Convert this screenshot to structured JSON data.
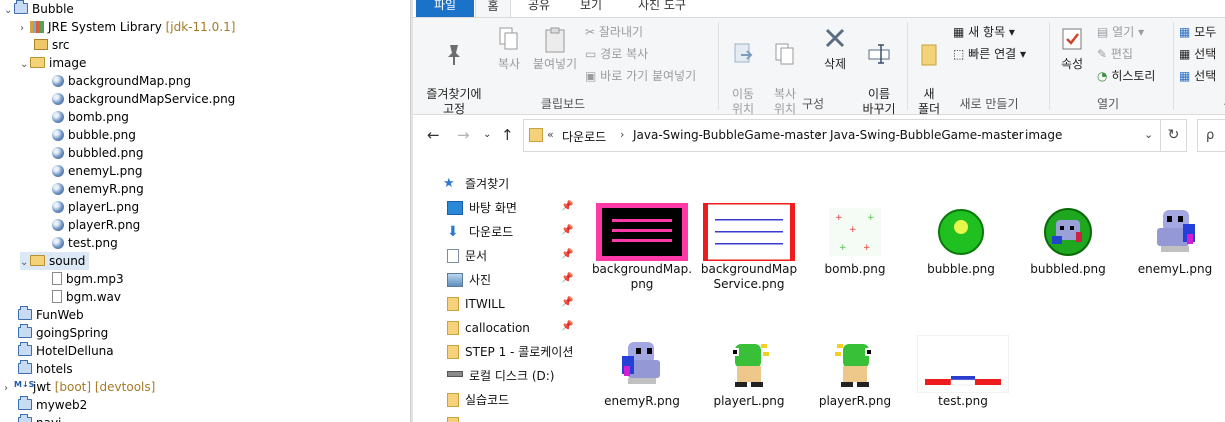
{
  "tree": {
    "items": [
      {
        "label": "Bubble",
        "deco": ""
      },
      {
        "label": "JRE System Library",
        "deco": "[jdk-11.0.1]"
      },
      {
        "label": "src",
        "deco": ""
      },
      {
        "label": "image",
        "deco": ""
      },
      {
        "label": "backgroundMap.png",
        "deco": ""
      },
      {
        "label": "backgroundMapService.png",
        "deco": ""
      },
      {
        "label": "bomb.png",
        "deco": ""
      },
      {
        "label": "bubble.png",
        "deco": ""
      },
      {
        "label": "bubbled.png",
        "deco": ""
      },
      {
        "label": "enemyL.png",
        "deco": ""
      },
      {
        "label": "enemyR.png",
        "deco": ""
      },
      {
        "label": "playerL.png",
        "deco": ""
      },
      {
        "label": "playerR.png",
        "deco": ""
      },
      {
        "label": "test.png",
        "deco": ""
      },
      {
        "label": "sound",
        "deco": ""
      },
      {
        "label": "bgm.mp3",
        "deco": ""
      },
      {
        "label": "bgm.wav",
        "deco": ""
      },
      {
        "label": "FunWeb",
        "deco": ""
      },
      {
        "label": "goingSpring",
        "deco": ""
      },
      {
        "label": "HotelDelluna",
        "deco": ""
      },
      {
        "label": "hotels",
        "deco": ""
      },
      {
        "label": "jwt",
        "deco": "[boot] [devtools]"
      },
      {
        "label": "myweb2",
        "deco": ""
      },
      {
        "label": "navi",
        "deco": ""
      }
    ]
  },
  "explorer": {
    "tabs": [
      "파일",
      "홈",
      "공유",
      "보기",
      "사진 도구"
    ],
    "ribbon": {
      "clipboard": {
        "pin_label": "즐겨찾기에\n고정",
        "copy_label": "복사",
        "paste_label": "붙여넣기",
        "cut_label": "잘라내기",
        "copy_path_label": "경로 복사",
        "paste_shortcut_label": "바로 가기 붙여넣기",
        "group_label": "클립보드"
      },
      "organize": {
        "move_label": "이동\n위치",
        "copyto_label": "복사\n위치",
        "delete_label": "삭제",
        "rename_label": "이름\n바꾸기",
        "group_label": "구성"
      },
      "new": {
        "new_folder_label": "새\n폴더",
        "new_item_label": "새 항목",
        "easy_access_label": "빠른 연결",
        "group_label": "새로 만들기"
      },
      "open": {
        "properties_label": "속성",
        "open_label": "열기",
        "edit_label": "편집",
        "history_label": "히스토리",
        "group_label": "열기"
      },
      "select": {
        "select_all_label": "모두",
        "select_none_label": "선택",
        "invert_label": "선택",
        "group_label": "선"
      }
    },
    "address": {
      "prefix": "«",
      "crumbs": [
        "다운로드",
        "Java-Swing-BubbleGame-master",
        "Java-Swing-BubbleGame-master",
        "image"
      ],
      "search_icon_text": "ρ"
    },
    "nav": {
      "items": [
        {
          "label": "즐겨찾기",
          "pinned": false
        },
        {
          "label": "바탕 화면",
          "pinned": true
        },
        {
          "label": "다운로드",
          "pinned": true
        },
        {
          "label": "문서",
          "pinned": true
        },
        {
          "label": "사진",
          "pinned": true
        },
        {
          "label": "ITWILL",
          "pinned": true
        },
        {
          "label": "callocation",
          "pinned": true
        },
        {
          "label": "STEP 1 - 콜로케이션",
          "pinned": false
        },
        {
          "label": "로컬 디스크 (D:)",
          "pinned": false
        },
        {
          "label": "실습코드",
          "pinned": false
        },
        {
          "label": "...",
          "pinned": false
        }
      ]
    },
    "files": [
      {
        "name": "backgroundMap.\npng",
        "icon": "backgroundMap-thumb"
      },
      {
        "name": "backgroundMap\nService.png",
        "icon": "backgroundMapService-thumb"
      },
      {
        "name": "bomb.png",
        "icon": "bomb-thumb"
      },
      {
        "name": "bubble.png",
        "icon": "bubble-thumb"
      },
      {
        "name": "bubbled.png",
        "icon": "bubbled-thumb"
      },
      {
        "name": "enemyL.png",
        "icon": "enemyL-thumb"
      },
      {
        "name": "enemyR.png",
        "icon": "enemyR-thumb"
      },
      {
        "name": "playerL.png",
        "icon": "playerL-thumb"
      },
      {
        "name": "playerR.png",
        "icon": "playerR-thumb"
      },
      {
        "name": "test.png",
        "icon": "test-thumb"
      }
    ]
  },
  "colors": {
    "ribbon_bg": "#f5f6f7",
    "file_tab": "#1a73c8",
    "folder": "#f4d27a",
    "decoration": "#a57b2a"
  }
}
